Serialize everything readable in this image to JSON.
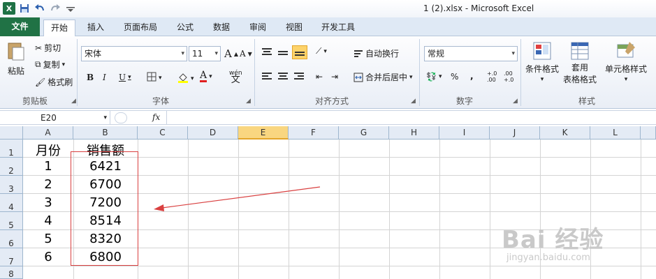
{
  "window": {
    "title": "1 (2).xlsx - Microsoft Excel"
  },
  "tabs": [
    {
      "label": "文件"
    },
    {
      "label": "开始"
    },
    {
      "label": "插入"
    },
    {
      "label": "页面布局"
    },
    {
      "label": "公式"
    },
    {
      "label": "数据"
    },
    {
      "label": "审阅"
    },
    {
      "label": "视图"
    },
    {
      "label": "开发工具"
    }
  ],
  "ribbon": {
    "clipboard": {
      "paste": "粘贴",
      "cut": "剪切",
      "copy": "复制",
      "format_painter": "格式刷",
      "group": "剪贴板"
    },
    "font": {
      "name": "宋体",
      "size": "11",
      "bold": "B",
      "italic": "I",
      "underline": "U",
      "group": "字体",
      "grow": "A",
      "shrink": "A",
      "wen": "wén",
      "wen_char": "文"
    },
    "alignment": {
      "wrap": "自动换行",
      "merge": "合并后居中",
      "group": "对齐方式"
    },
    "number": {
      "format": "常规",
      "percent": "%",
      "comma": ",",
      "inc": "+.0 .00",
      "dec": ".00 +.0",
      "group": "数字"
    },
    "styles": {
      "conditional": "条件格式",
      "table_1": "套用",
      "table_2": "表格格式",
      "cell_styles": "单元格样式",
      "group": "样式"
    }
  },
  "formula_bar": {
    "name_box": "E20",
    "fx": "fx",
    "value": ""
  },
  "columns": [
    "A",
    "B",
    "C",
    "D",
    "E",
    "F",
    "G",
    "H",
    "I",
    "J",
    "K",
    "L"
  ],
  "rows": [
    "1",
    "2",
    "3",
    "4",
    "5",
    "6",
    "7",
    "8"
  ],
  "selected_column": "E",
  "table": {
    "header": [
      "月份",
      "销售额"
    ],
    "rows": [
      [
        "1",
        "6421"
      ],
      [
        "2",
        "6700"
      ],
      [
        "3",
        "7200"
      ],
      [
        "4",
        "8514"
      ],
      [
        "5",
        "8320"
      ],
      [
        "6",
        "6800"
      ]
    ]
  },
  "watermark": {
    "brand": "Bai 经验",
    "url": "jingyan.baidu.com"
  },
  "colors": {
    "file_tab": "#207245",
    "selected_col": "#f9d680",
    "annotation": "#d94040"
  }
}
